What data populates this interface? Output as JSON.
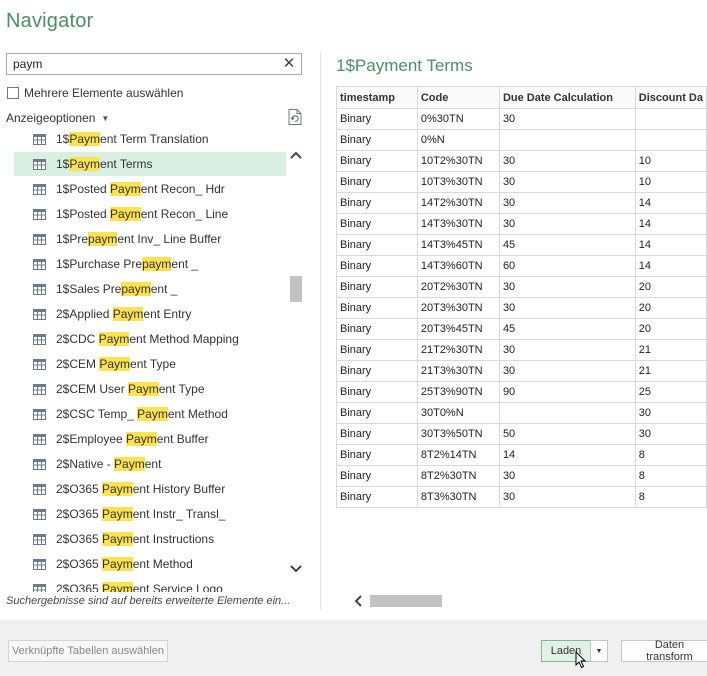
{
  "window": {
    "title": "Navigator"
  },
  "search": {
    "value": "paym",
    "clear_icon": "close-icon"
  },
  "multi_select": {
    "label": "Mehrere Elemente auswählen",
    "checked": false
  },
  "display_options": {
    "label": "Anzeigeoptionen"
  },
  "tree": {
    "items": [
      {
        "pre": "1$",
        "hl": "Paym",
        "post": "ent Term Translation",
        "selected": false
      },
      {
        "pre": "1$",
        "hl": "Paym",
        "post": "ent Terms",
        "selected": true
      },
      {
        "pre": "1$Posted ",
        "hl": "Paym",
        "post": "ent Recon_ Hdr",
        "selected": false
      },
      {
        "pre": "1$Posted ",
        "hl": "Paym",
        "post": "ent Recon_ Line",
        "selected": false
      },
      {
        "pre": "1$Pre",
        "hl": "paym",
        "post": "ent Inv_ Line Buffer",
        "selected": false
      },
      {
        "pre": "1$Purchase Pre",
        "hl": "paym",
        "post": "ent _",
        "selected": false
      },
      {
        "pre": "1$Sales Pre",
        "hl": "paym",
        "post": "ent _",
        "selected": false
      },
      {
        "pre": "2$Applied ",
        "hl": "Paym",
        "post": "ent Entry",
        "selected": false
      },
      {
        "pre": "2$CDC ",
        "hl": "Paym",
        "post": "ent Method Mapping",
        "selected": false
      },
      {
        "pre": "2$CEM ",
        "hl": "Paym",
        "post": "ent Type",
        "selected": false
      },
      {
        "pre": "2$CEM User ",
        "hl": "Paym",
        "post": "ent Type",
        "selected": false
      },
      {
        "pre": "2$CSC Temp_ ",
        "hl": "Paym",
        "post": "ent Method",
        "selected": false
      },
      {
        "pre": "2$Employee ",
        "hl": "Paym",
        "post": "ent Buffer",
        "selected": false
      },
      {
        "pre": "2$Native - ",
        "hl": "Paym",
        "post": "ent",
        "selected": false
      },
      {
        "pre": "2$O365 ",
        "hl": "Paym",
        "post": "ent History Buffer",
        "selected": false
      },
      {
        "pre": "2$O365 ",
        "hl": "Paym",
        "post": "ent Instr_ Transl_",
        "selected": false
      },
      {
        "pre": "2$O365 ",
        "hl": "Paym",
        "post": "ent Instructions",
        "selected": false
      },
      {
        "pre": "2$O365 ",
        "hl": "Paym",
        "post": "ent Method",
        "selected": false
      },
      {
        "pre": "2$O365 ",
        "hl": "Paym",
        "post": "ent Service Logo",
        "selected": false
      }
    ]
  },
  "hint": "Suchergebnisse sind auf bereits erweiterte Elemente ein...",
  "preview": {
    "title": "1$Payment Terms",
    "columns": [
      "timestamp",
      "Code",
      "Due Date Calculation",
      "Discount Da"
    ],
    "rows": [
      [
        "Binary",
        "0%30TN",
        "30",
        ""
      ],
      [
        "Binary",
        "0%N",
        "",
        ""
      ],
      [
        "Binary",
        "10T2%30TN",
        "30",
        "10"
      ],
      [
        "Binary",
        "10T3%30TN",
        "30",
        "10"
      ],
      [
        "Binary",
        "14T2%30TN",
        "30",
        "14"
      ],
      [
        "Binary",
        "14T3%30TN",
        "30",
        "14"
      ],
      [
        "Binary",
        "14T3%45TN",
        "45",
        "14"
      ],
      [
        "Binary",
        "14T3%60TN",
        "60",
        "14"
      ],
      [
        "Binary",
        "20T2%30TN",
        "30",
        "20"
      ],
      [
        "Binary",
        "20T3%30TN",
        "30",
        "20"
      ],
      [
        "Binary",
        "20T3%45TN",
        "45",
        "20"
      ],
      [
        "Binary",
        "21T2%30TN",
        "30",
        "21"
      ],
      [
        "Binary",
        "21T3%30TN",
        "30",
        "21"
      ],
      [
        "Binary",
        "25T3%90TN",
        "90",
        "25"
      ],
      [
        "Binary",
        "30T0%N",
        "",
        "30"
      ],
      [
        "Binary",
        "30T3%50TN",
        "50",
        "30"
      ],
      [
        "Binary",
        "8T2%14TN",
        "14",
        "8"
      ],
      [
        "Binary",
        "8T2%30TN",
        "30",
        "8"
      ],
      [
        "Binary",
        "8T3%30TN",
        "30",
        "8"
      ]
    ]
  },
  "footer": {
    "linked_tables_label": "Verknüpfte Tabellen auswählen",
    "load_label": "Laden",
    "transform_label": "Daten transform"
  },
  "colors": {
    "accent": "#4a8f65",
    "highlight": "#fde34f",
    "selected_row": "#d9efe1"
  }
}
